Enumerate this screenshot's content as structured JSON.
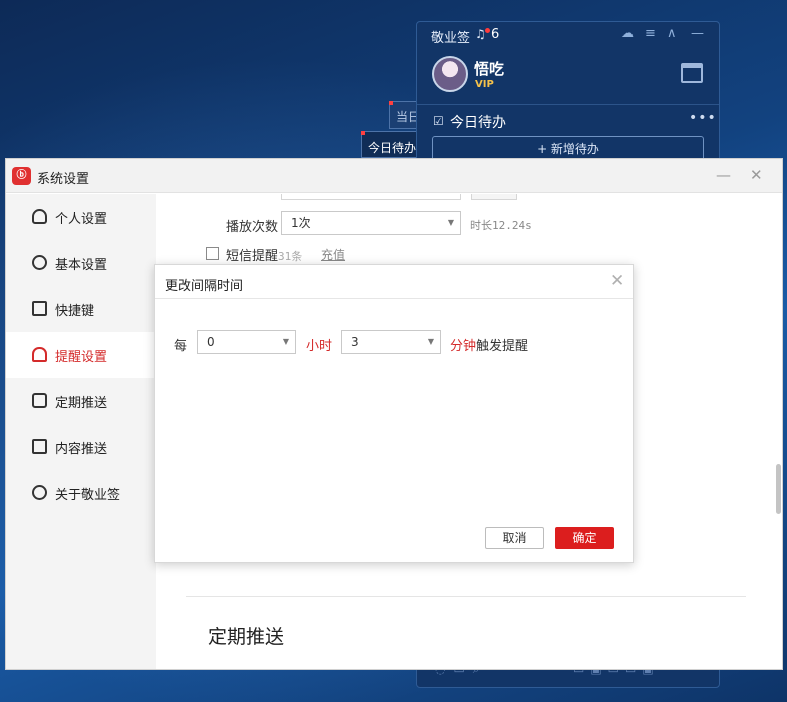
{
  "colors": {
    "accent_red": "#dc1e1e",
    "nav_active": "#d42b2b",
    "widget_bg": "#123567"
  },
  "widget": {
    "title": "敬业签",
    "notification_count": "6",
    "user_name": "悟吃",
    "vip_badge": "VIP",
    "todo_title": "今日待办",
    "add_todo_label": "+ 新增待办",
    "more_label": "•••",
    "controls": {
      "cloud": "☁",
      "menu": "≡",
      "collapse": "∧",
      "minimize": "—"
    }
  },
  "stickies": {
    "back_label": "当日",
    "front_label": "今日待办"
  },
  "settings": {
    "title": "系统设置",
    "logo_text": "ⓑ",
    "minimize_glyph": "—",
    "close_glyph": "✕",
    "nav": [
      {
        "label": "个人设置",
        "icon": "user-icon",
        "active": false
      },
      {
        "label": "基本设置",
        "icon": "gear-icon",
        "active": false
      },
      {
        "label": "快捷键",
        "icon": "keyboard-icon",
        "active": false
      },
      {
        "label": "提醒设置",
        "icon": "bell-icon",
        "active": true
      },
      {
        "label": "定期推送",
        "icon": "clock-icon",
        "active": false
      },
      {
        "label": "内容推送",
        "icon": "document-icon",
        "active": false
      },
      {
        "label": "关于敬业签",
        "icon": "info-icon",
        "active": false
      }
    ],
    "content": {
      "play_count_label": "播放次数",
      "play_count_value": "1次",
      "duration_hint": "时长12.24s",
      "sms_label": "短信提醒",
      "sms_remaining": "31条",
      "recharge_link": "充值",
      "section_title": "定期推送"
    }
  },
  "dialog": {
    "title": "更改间隔时间",
    "close_glyph": "✕",
    "every_label": "每",
    "hours_value": "0",
    "hours_unit": "小时",
    "minutes_value": "3",
    "minutes_unit": "分钟",
    "trigger_text": "触发提醒",
    "cancel_label": "取消",
    "ok_label": "确定"
  }
}
